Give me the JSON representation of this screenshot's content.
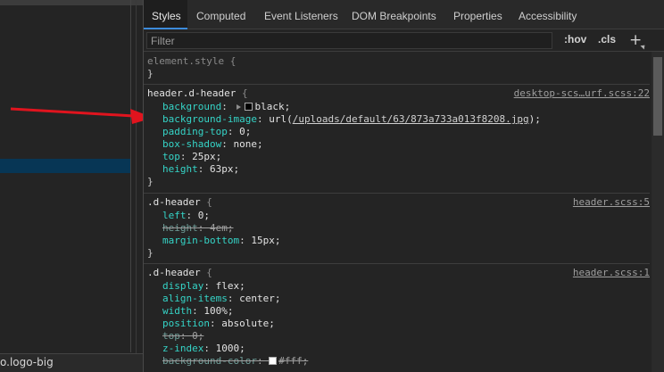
{
  "left_pane": {
    "breadcrumb": "o.logo-big"
  },
  "tabs": [
    {
      "label": "Styles",
      "active": true
    },
    {
      "label": "Computed",
      "active": false
    },
    {
      "label": "Event Listeners",
      "active": false
    },
    {
      "label": "DOM Breakpoints",
      "active": false
    },
    {
      "label": "Properties",
      "active": false
    },
    {
      "label": "Accessibility",
      "active": false
    }
  ],
  "filter": {
    "placeholder": "Filter",
    "hov_label": ":hov",
    "cls_label": ".cls",
    "add_label": "+"
  },
  "rules": {
    "element_style": {
      "selector": "element.style",
      "open": "{",
      "close": "}"
    },
    "rule1": {
      "selector": "header.d-header",
      "open": "{",
      "close": "}",
      "source": "desktop-scs…urf.scss:22",
      "decl": [
        {
          "prop": "background",
          "val": "black;"
        },
        {
          "prop": "background-image",
          "val_prefix": "url(",
          "url": "/uploads/default/63/873a733a013f8208.jpg",
          "val_suffix": ");"
        },
        {
          "prop": "padding-top",
          "val": "0;"
        },
        {
          "prop": "box-shadow",
          "val": "none;"
        },
        {
          "prop": "top",
          "val": "25px;"
        },
        {
          "prop": "height",
          "val": "63px;"
        }
      ]
    },
    "rule2": {
      "selector": ".d-header",
      "open": "{",
      "close": "}",
      "source": "header.scss:5",
      "decl": [
        {
          "prop": "left",
          "val": "0;"
        },
        {
          "prop": "height",
          "val": "4em;"
        },
        {
          "prop": "margin-bottom",
          "val": "15px;"
        }
      ]
    },
    "rule3": {
      "selector": ".d-header",
      "open": "{",
      "source": "header.scss:1",
      "decl": [
        {
          "prop": "display",
          "val": "flex;"
        },
        {
          "prop": "align-items",
          "val": "center;"
        },
        {
          "prop": "width",
          "val": "100%;"
        },
        {
          "prop": "position",
          "val": "absolute;"
        },
        {
          "prop": "top",
          "val": "0;"
        },
        {
          "prop": "z-index",
          "val": "1000;"
        },
        {
          "prop": "background-color",
          "val": "#fff;"
        }
      ]
    }
  },
  "colors": {
    "accent": "#3c8bdb",
    "selected_row": "#073655",
    "property": "#35d4c7",
    "arrow": "#e0141e"
  }
}
